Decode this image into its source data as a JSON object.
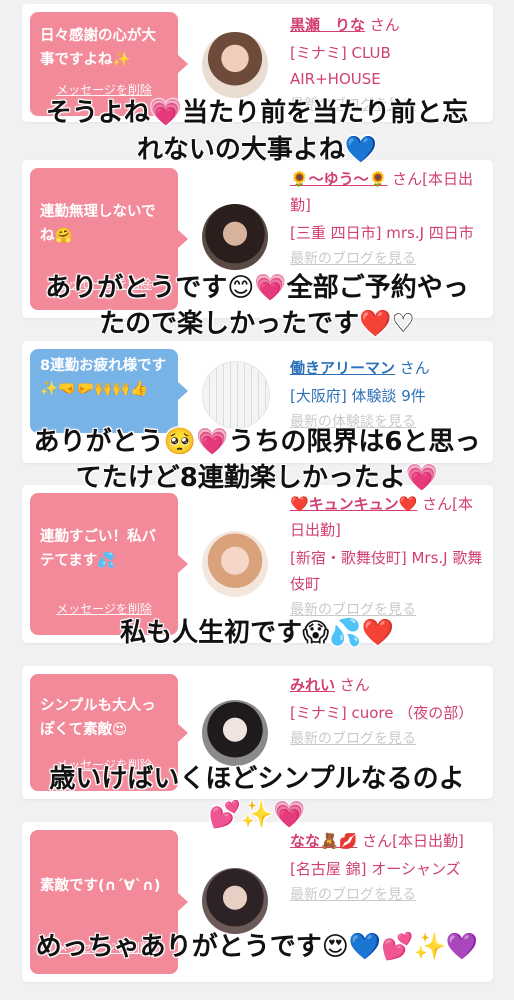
{
  "entries": [
    {
      "bubble": "日々感謝の心が大事ですよね✨",
      "delete_label": "メッセージを削除",
      "name": "黒瀬　りな",
      "honorific": "さん",
      "shop": "[ミナミ] CLUB AIR+HOUSE",
      "blog_link": "最新のブログを見る",
      "caption": [
        "そうよね💗当たり前を当たり前と忘",
        "れないの大事よね💙"
      ]
    },
    {
      "bubble": "連勤無理しないでね🤗",
      "delete_label": "メッセージを削除",
      "name": "🌻〜ゆう〜🌻",
      "honorific": "さん[本日出勤]",
      "shop": "[三重 四日市] mrs.J 四日市",
      "blog_link": "最新のブログを見る",
      "caption": [
        "ありがとうです😊💗全部ご予約やっ",
        "たので楽しかったです❤️♡"
      ]
    },
    {
      "bubble": "8連勤お疲れ様です✨🤜🤛🙌🙌👍",
      "delete_label": "",
      "name": "働きアリーマン",
      "honorific": "さん",
      "shop": "[大阪府] 体験談 9件",
      "blog_link": "最新の体験談を見る",
      "caption": [
        "ありがとう🥺💗うちの限界は6と思っ",
        "てたけど8連勤楽しかったよ💗"
      ]
    },
    {
      "bubble": "連勤すごい！私バテてます💦",
      "delete_label": "メッセージを削除",
      "name": "❤️キュンキュン❤️",
      "honorific": "さん[本日出勤]",
      "shop": "[新宿・歌舞伎町] Mrs.J 歌舞伎町",
      "blog_link": "最新のブログを見る",
      "caption": [
        "私も人生初です😱💦❤️"
      ]
    },
    {
      "bubble": "シンプルも大人っぽくて素敵😍",
      "delete_label": "メッセージを削除",
      "name": "みれい",
      "honorific": "さん",
      "shop": "[ミナミ] cuore （夜の部）",
      "blog_link": "最新のブログを見る",
      "caption": [
        "歳いけばいくほどシンプルなるのよ",
        "💕✨💗"
      ]
    },
    {
      "bubble": "素敵です(∩´∀`∩)",
      "delete_label": "メッセージを削除",
      "name": "なな🧸💋",
      "honorific": "さん[本日出勤]",
      "shop": "[名古屋 錦] オーシャンズ",
      "blog_link": "最新のブログを見る",
      "caption": [
        "めっちゃありがとうです😍💙💕✨💜"
      ]
    }
  ],
  "colors": {
    "pink_bubble": "#f28a9a",
    "blue_bubble": "#78b3e8",
    "name_pink": "#d23f72",
    "name_blue": "#2c70b8",
    "background": "#f1f1f3"
  }
}
